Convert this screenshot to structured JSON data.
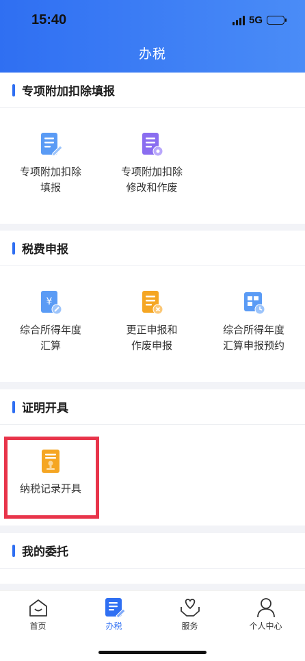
{
  "status": {
    "time": "15:40",
    "network": "5G"
  },
  "header": {
    "title": "办税"
  },
  "sections": [
    {
      "title": "专项附加扣除填报",
      "items": [
        {
          "line1": "专项附加扣除",
          "line2": "填报"
        },
        {
          "line1": "专项附加扣除",
          "line2": "修改和作废"
        }
      ]
    },
    {
      "title": "税费申报",
      "items": [
        {
          "line1": "综合所得年度",
          "line2": "汇算"
        },
        {
          "line1": "更正申报和",
          "line2": "作废申报"
        },
        {
          "line1": "综合所得年度",
          "line2": "汇算申报预约"
        }
      ]
    },
    {
      "title": "证明开具",
      "items": [
        {
          "line1": "纳税记录开具",
          "line2": ""
        }
      ]
    },
    {
      "title": "我的委托",
      "items": []
    }
  ],
  "tabs": [
    {
      "label": "首页"
    },
    {
      "label": "办税"
    },
    {
      "label": "服务"
    },
    {
      "label": "个人中心"
    }
  ],
  "colors": {
    "brand": "#2f6ff2",
    "highlight": "#e8344a"
  }
}
